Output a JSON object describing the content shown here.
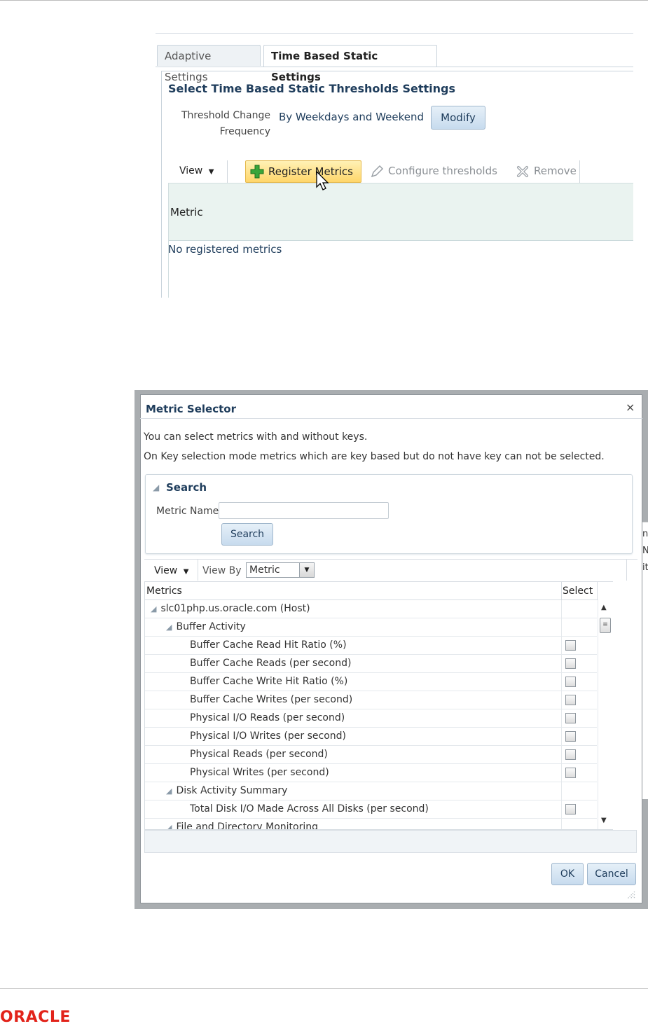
{
  "tabs": [
    {
      "label": "Adaptive Settings",
      "active": false
    },
    {
      "label": "Time Based Static Settings",
      "active": true
    }
  ],
  "panel": {
    "title": "Select Time Based Static Thresholds Settings",
    "threshold_label_line1": "Threshold Change",
    "threshold_label_line2": "Frequency",
    "threshold_value": "By Weekdays and Weekend",
    "modify_label": "Modify"
  },
  "toolbar": {
    "view_label": "View",
    "register_label": "Register Metrics",
    "configure_label": "Configure thresholds",
    "remove_label": "Remove"
  },
  "table": {
    "metric_header": "Metric",
    "empty_text": "No registered metrics"
  },
  "dialog": {
    "title": "Metric Selector",
    "close": "×",
    "info_line1": "You can select metrics with and without keys.",
    "info_line2": "On Key selection mode metrics which are key based but do not have key can not be selected.",
    "search": {
      "title": "Search",
      "metric_name_label": "Metric Name",
      "metric_name_value": "",
      "button_label": "Search"
    },
    "toolbar": {
      "view_label": "View",
      "view_by_label": "View By",
      "view_by_value": "Metric"
    },
    "grid": {
      "col_metrics": "Metrics",
      "col_select": "Select",
      "rows": [
        {
          "label": "slc01php.us.oracle.com (Host)",
          "level": 0,
          "group": true,
          "checkbox": false
        },
        {
          "label": "Buffer Activity",
          "level": 1,
          "group": true,
          "checkbox": false
        },
        {
          "label": "Buffer Cache Read Hit Ratio (%)",
          "level": 2,
          "group": false,
          "checkbox": true
        },
        {
          "label": "Buffer Cache Reads (per second)",
          "level": 2,
          "group": false,
          "checkbox": true
        },
        {
          "label": "Buffer Cache Write Hit Ratio (%)",
          "level": 2,
          "group": false,
          "checkbox": true
        },
        {
          "label": "Buffer Cache Writes (per second)",
          "level": 2,
          "group": false,
          "checkbox": true
        },
        {
          "label": "Physical I/O Reads (per second)",
          "level": 2,
          "group": false,
          "checkbox": true
        },
        {
          "label": "Physical I/O Writes (per second)",
          "level": 2,
          "group": false,
          "checkbox": true
        },
        {
          "label": "Physical Reads (per second)",
          "level": 2,
          "group": false,
          "checkbox": true
        },
        {
          "label": "Physical Writes (per second)",
          "level": 2,
          "group": false,
          "checkbox": true
        },
        {
          "label": "Disk Activity Summary",
          "level": 1,
          "group": true,
          "checkbox": false
        },
        {
          "label": "Total Disk I/O Made Across All Disks (per second)",
          "level": 2,
          "group": false,
          "checkbox": true
        },
        {
          "label": "File and Directory Monitoring",
          "level": 1,
          "group": true,
          "checkbox": false
        }
      ]
    },
    "ok_label": "OK",
    "cancel_label": "Cancel"
  },
  "behind_text": [
    "nd",
    "Ni",
    "it"
  ],
  "footer": {
    "logo": "ORACLE"
  },
  "colors": {
    "accent": "#1f3d5c",
    "brand_red": "#e2231a",
    "highlight": "#ffd66a"
  }
}
